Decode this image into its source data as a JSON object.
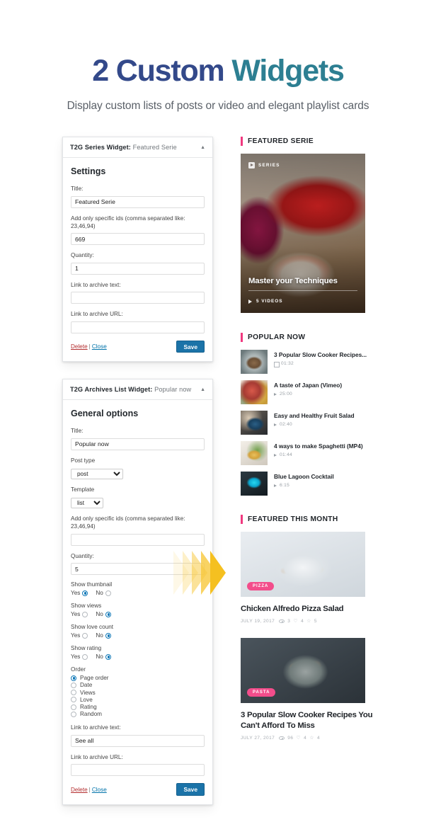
{
  "hero": {
    "title_part1": "2 Custom ",
    "title_part2": "Widgets",
    "subtitle": "Display custom lists of posts or video and elegant playlist cards",
    "color_part1": "#33498a",
    "color_part2": "#2d7f92"
  },
  "widgets": [
    {
      "header_bold": "T2G Series Widget:",
      "header_light": " Featured Serie",
      "section_title": "Settings",
      "fields": [
        {
          "label": "Title:",
          "value": "Featured Serie"
        },
        {
          "label": "Add only specific ids (comma separated like: 23,46,94)",
          "value": "669"
        },
        {
          "label": "Quantity:",
          "value": "1"
        },
        {
          "label": "Link to archive text:",
          "value": ""
        },
        {
          "label": "Link to archive URL:",
          "value": ""
        }
      ],
      "delete_label": "Delete",
      "separator": "|",
      "close_label": "Close",
      "save_label": "Save"
    },
    {
      "header_bold": "T2G Archives List Widget:",
      "header_light": " Popular now",
      "section_title": "General options",
      "title_field": {
        "label": "Title:",
        "value": "Popular now"
      },
      "post_type": {
        "label": "Post type",
        "value": "post"
      },
      "template": {
        "label": "Template",
        "value": "list"
      },
      "ids_field": {
        "label": "Add only specific ids (comma separated like: 23,46,94)",
        "value": ""
      },
      "quantity": {
        "label": "Quantity:",
        "value": "5"
      },
      "toggles": [
        {
          "label": "Show thumbnail",
          "yes": "Yes",
          "no": "No",
          "selected": "yes"
        },
        {
          "label": "Show views",
          "yes": "Yes",
          "no": "No",
          "selected": "no"
        },
        {
          "label": "Show love count",
          "yes": "Yes",
          "no": "No",
          "selected": "no"
        },
        {
          "label": "Show rating",
          "yes": "Yes",
          "no": "No",
          "selected": "no"
        }
      ],
      "order": {
        "label": "Order",
        "options": [
          "Page order",
          "Date",
          "Views",
          "Love",
          "Rating",
          "Random"
        ],
        "selected": "Page order"
      },
      "archive_text": {
        "label": "Link to archive text:",
        "value": "See all"
      },
      "archive_url": {
        "label": "Link to archive URL:",
        "value": ""
      },
      "delete_label": "Delete",
      "separator": "|",
      "close_label": "Close",
      "save_label": "Save"
    }
  ],
  "preview": {
    "accent_color": "#f0397f",
    "featured_serie": {
      "heading": "FEATURED SERIE",
      "badge": "SERIES",
      "title": "Master your Techniques",
      "meta": "5 VIDEOS"
    },
    "popular_now": {
      "heading": "POPULAR NOW",
      "items": [
        {
          "title": "3 Popular Slow Cooker Recipes...",
          "duration": "01:32",
          "thumb": "ph-cooker",
          "icon": "film-icon"
        },
        {
          "title": "A taste of Japan (Vimeo)",
          "duration": "25:00",
          "thumb": "ph-japan",
          "icon": "play-icon"
        },
        {
          "title": "Easy and Healthy Fruit Salad",
          "duration": "02:40",
          "thumb": "ph-fruit",
          "icon": "play-icon"
        },
        {
          "title": "4 ways to make Spaghetti (MP4)",
          "duration": "01:44",
          "thumb": "ph-spag",
          "icon": "play-icon"
        },
        {
          "title": "Blue Lagoon Cocktail",
          "duration": "6:15",
          "thumb": "ph-lagoon",
          "icon": "play-icon"
        }
      ]
    },
    "featured_this_month": {
      "heading": "FEATURED THIS MONTH",
      "cards": [
        {
          "category": "PIZZA",
          "title": "Chicken Alfredo Pizza Salad",
          "date": "JULY 19, 2017",
          "views": "3",
          "loves": "4",
          "rating": "5",
          "thumb": "ph-pizza"
        },
        {
          "category": "PASTA",
          "title": "3 Popular Slow Cooker Recipes You Can't Afford To Miss",
          "date": "JULY 27, 2017",
          "views": "96",
          "loves": "4",
          "rating": "4",
          "thumb": "ph-pasta"
        }
      ]
    }
  }
}
